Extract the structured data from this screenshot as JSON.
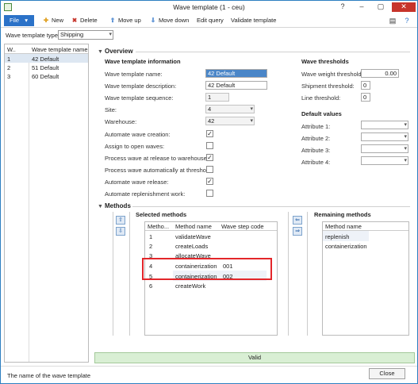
{
  "window": {
    "title": "Wave template (1 - ceu)",
    "controls": {
      "help": "?",
      "minimize": "–",
      "maximize": "▢",
      "close": "✕"
    }
  },
  "toolbar": {
    "file_label": "File",
    "file_arrow": "▾",
    "new_label": "New",
    "delete_label": "Delete",
    "move_up_label": "Move up",
    "move_down_label": "Move down",
    "edit_query_label": "Edit query",
    "validate_label": "Validate template",
    "icons": {
      "new": "✚",
      "delete": "✖",
      "move_up": "⇧",
      "move_down": "⇩",
      "view": "▤",
      "help": "?"
    }
  },
  "filter": {
    "label": "Wave template type:",
    "value": "Shipping"
  },
  "template_list": {
    "headers": [
      "W..",
      "Wave template name"
    ],
    "rows": [
      {
        "num": "1",
        "name": "42 Default",
        "selected": true
      },
      {
        "num": "2",
        "name": "51 Default",
        "selected": false
      },
      {
        "num": "3",
        "name": "60 Default",
        "selected": false
      }
    ]
  },
  "overview": {
    "section_title": "Overview",
    "info_title": "Wave template information",
    "name_label": "Wave template name:",
    "name_value": "42 Default",
    "desc_label": "Wave template description:",
    "desc_value": "42 Default",
    "seq_label": "Wave template sequence:",
    "seq_value": "1",
    "site_label": "Site:",
    "site_value": "4",
    "warehouse_label": "Warehouse:",
    "warehouse_value": "42",
    "checks": [
      {
        "label": "Automate wave creation:",
        "checked": true
      },
      {
        "label": "Assign to open waves:",
        "checked": false
      },
      {
        "label": "Process wave at release to warehouse:",
        "checked": true
      },
      {
        "label": "Process wave automatically at threshold:",
        "checked": false
      },
      {
        "label": "Automate wave release:",
        "checked": true
      },
      {
        "label": "Automate replenishment work:",
        "checked": false
      }
    ],
    "check_mark": "✓",
    "thresholds_title": "Wave thresholds",
    "weight_label": "Wave weight threshold:",
    "weight_value": "0.00",
    "shipment_label": "Shipment threshold:",
    "shipment_value": "0",
    "line_label": "Line threshold:",
    "line_value": "0",
    "defaults_title": "Default values",
    "attributes": [
      "Attribute 1:",
      "Attribute 2:",
      "Attribute 3:",
      "Attribute 4:"
    ]
  },
  "methods": {
    "section_title": "Methods",
    "selected_title": "Selected methods",
    "selected_headers": [
      "Metho...",
      "Method name",
      "Wave step code"
    ],
    "selected_rows": [
      {
        "num": "1",
        "name": "validateWave",
        "code": ""
      },
      {
        "num": "2",
        "name": "createLoads",
        "code": ""
      },
      {
        "num": "3",
        "name": "allocateWave",
        "code": ""
      },
      {
        "num": "4",
        "name": "containerization",
        "code": "001"
      },
      {
        "num": "5",
        "name": "containerization",
        "code": "002"
      },
      {
        "num": "6",
        "name": "createWork",
        "code": ""
      }
    ],
    "remaining_title": "Remaining methods",
    "remaining_header": "Method name",
    "remaining_rows": [
      "replenish",
      "containerization"
    ],
    "up_arrow": "⇧",
    "down_arrow": "⇩",
    "left_arrow": "⇐",
    "right_arrow": "⇒"
  },
  "validation": {
    "text": "Valid"
  },
  "status": {
    "text": "The name of the wave template",
    "close_label": "Close"
  },
  "colors": {
    "accent": "#2b72c8",
    "valid_bg": "#d9efd4",
    "highlight": "#e3262a"
  }
}
